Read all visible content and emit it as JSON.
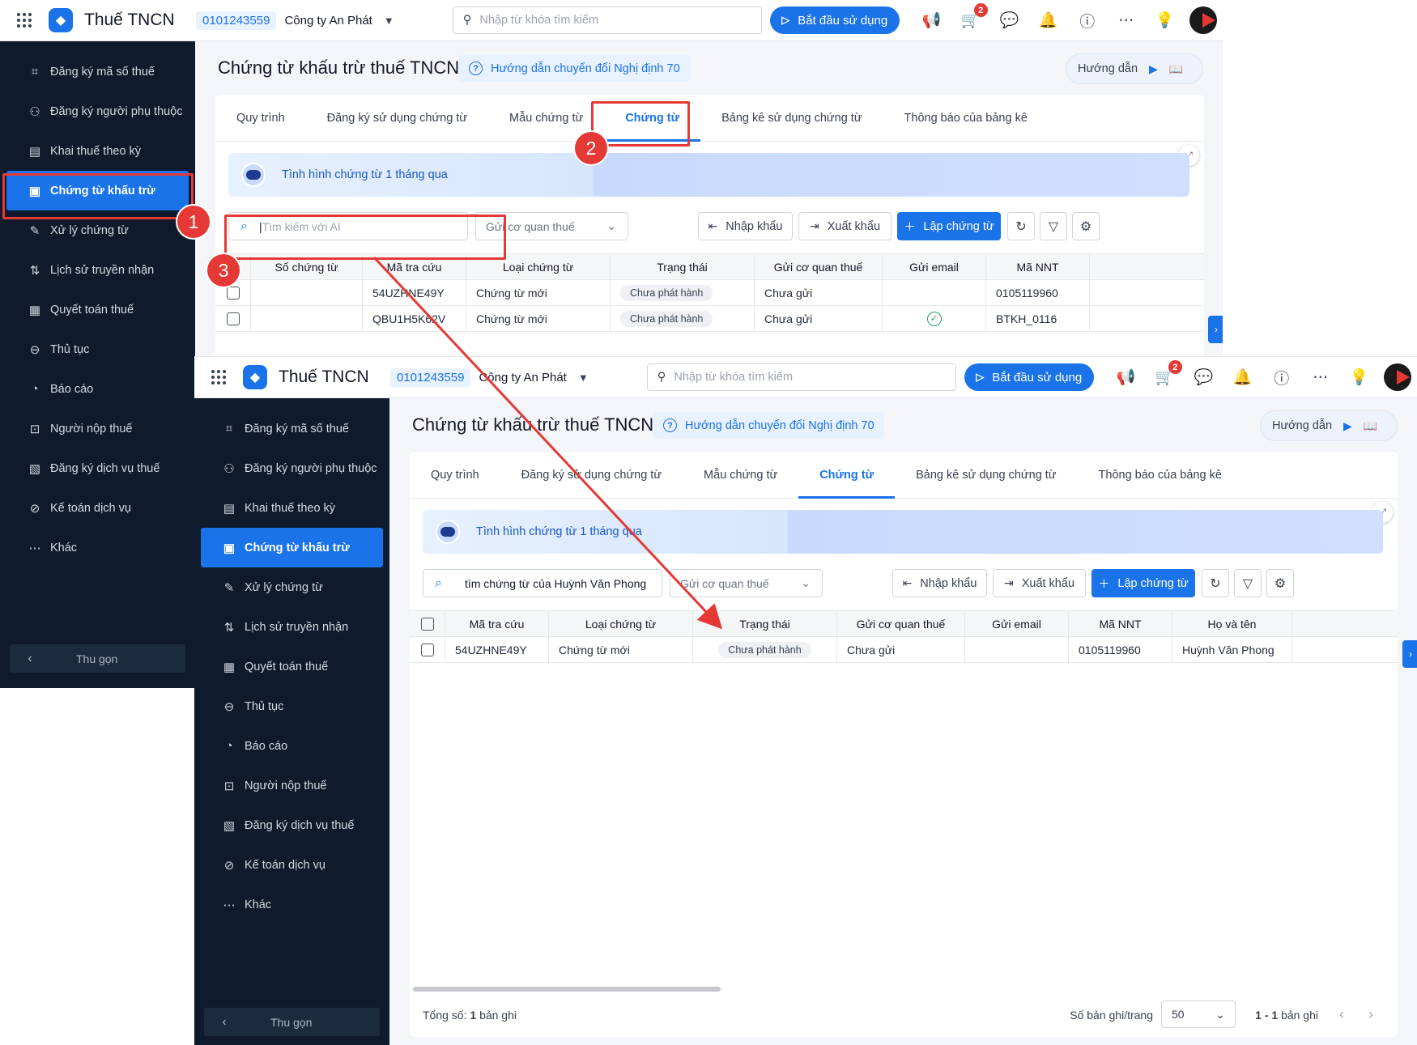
{
  "app": {
    "title": "Thuế TNCN",
    "tax_id": "0101243559",
    "company": "Công ty An Phát",
    "search_placeholder": "Nhập từ khóa tìm kiếm",
    "start_button": "Bắt đầu sử dụng",
    "cart_badge": "2"
  },
  "sidebar": {
    "items": [
      {
        "label": "Đăng ký mã số thuế",
        "icon": "id-scan-icon"
      },
      {
        "label": "Đăng ký người phụ thuộc",
        "icon": "users-icon"
      },
      {
        "label": "Khai thuế theo kỳ",
        "icon": "document-icon"
      },
      {
        "label": "Chứng từ khấu trừ",
        "icon": "receipt-icon"
      },
      {
        "label": "Xử lý chứng từ",
        "icon": "document-edit-icon"
      },
      {
        "label": "Lịch sử truyền nhận",
        "icon": "transfer-icon"
      },
      {
        "label": "Quyết toán thuế",
        "icon": "settlement-icon"
      },
      {
        "label": "Thủ tục",
        "icon": "procedure-icon"
      },
      {
        "label": "Báo cáo",
        "icon": "pie-chart-icon"
      },
      {
        "label": "Người nộp thuế",
        "icon": "taxpayer-icon"
      },
      {
        "label": "Đăng ký dịch vụ thuế",
        "icon": "service-icon"
      },
      {
        "label": "Kế toán dịch vụ",
        "icon": "accounting-icon"
      },
      {
        "label": "Khác",
        "icon": "more-icon"
      }
    ],
    "collapse": "Thu gọn"
  },
  "page": {
    "title": "Chứng từ khấu trừ thuế TNCN",
    "guide_link": "Hướng dẫn chuyển đổi Nghị định 70",
    "help_button": "Hướng dẫn",
    "tabs": [
      "Quy trình",
      "Đăng ký sử dụng chứng từ",
      "Mẫu chứng từ",
      "Chứng từ",
      "Bảng kê sử dụng chứng từ",
      "Thông báo của bảng kê"
    ],
    "banner": "Tình hình chứng từ 1 tháng qua",
    "filter_select": "Gửi cơ quan thuế",
    "import_button": "Nhập khẩu",
    "export_button": "Xuất khẩu",
    "create_button": "Lập chứng từ"
  },
  "shot1": {
    "search_placeholder": "Tìm kiếm với AI",
    "columns": [
      "Số chứng từ",
      "Mã tra cứu",
      "Loại chứng từ",
      "Trạng thái",
      "Gửi cơ quan thuế",
      "Gửi email",
      "Mã NNT"
    ],
    "rows": [
      [
        "",
        "54UZHNE49Y",
        "Chứng từ mới",
        "Chưa phát hành",
        "Chưa gửi",
        "",
        "0105119960"
      ],
      [
        "",
        "QBU1H5K62V",
        "Chứng từ mới",
        "Chưa phát hành",
        "Chưa gửi",
        "sent",
        "BTKH_0116"
      ]
    ]
  },
  "shot2": {
    "search_value": "tìm chứng từ của Huỳnh Văn Phong",
    "columns": [
      "Mã tra cứu",
      "Loại chứng từ",
      "Trạng thái",
      "Gửi cơ quan thuế",
      "Gửi email",
      "Mã NNT",
      "Họ và tên"
    ],
    "rows": [
      [
        "54UZHNE49Y",
        "Chứng từ mới",
        "Chưa phát hành",
        "Chưa gửi",
        "",
        "0105119960",
        "Huỳnh Văn Phong"
      ]
    ],
    "total_label": "Tổng số:",
    "total_count": "1",
    "total_unit": "bản ghi",
    "per_page_label": "Số bản ghi/trang",
    "per_page": "50",
    "range": "1 - 1",
    "range_unit": "bản ghi"
  },
  "steps": [
    "1",
    "2",
    "3"
  ],
  "colors": {
    "primary": "#1a73e8",
    "sidebar": "#0f1b2d",
    "annotation": "#e53935"
  }
}
